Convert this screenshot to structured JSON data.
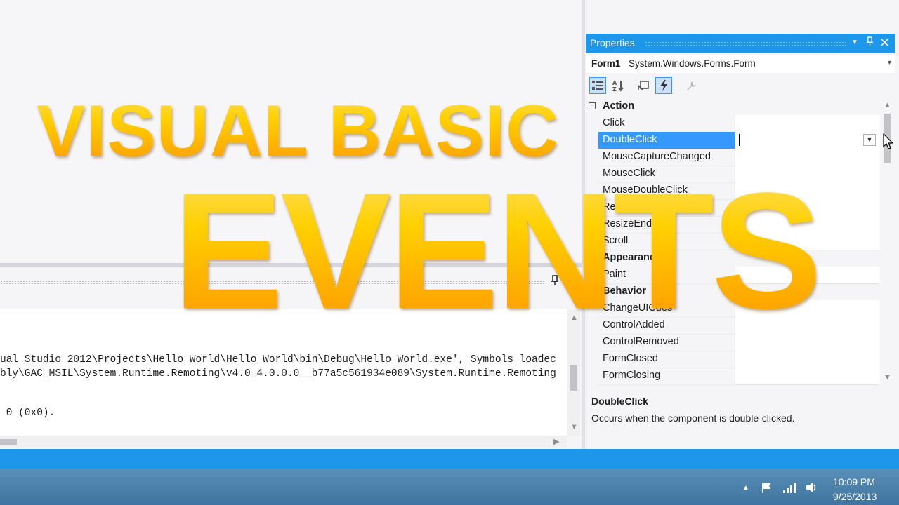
{
  "output": {
    "lines": [
      "ual Studio 2012\\Projects\\Hello World\\Hello World\\bin\\Debug\\Hello World.exe', Symbols loadec",
      "bly\\GAC_MSIL\\System.Runtime.Remoting\\v4.0_4.0.0.0__b77a5c561934e089\\System.Runtime.Remoting",
      "",
      " 0 (0x0)."
    ],
    "pin_icon": "pin-icon",
    "close_icon": "close-icon"
  },
  "properties": {
    "title": "Properties",
    "object_name": "Form1",
    "object_type": "System.Windows.Forms.Form",
    "toolbar": [
      "categorized-icon",
      "alphabetical-icon",
      "properties-icon",
      "events-icon",
      "property-pages-icon"
    ],
    "categories": {
      "action": "Action",
      "appearance": "Appearance",
      "behavior": "Behavior"
    },
    "action_events": [
      "Click",
      "DoubleClick",
      "MouseCaptureChanged",
      "MouseClick",
      "MouseDoubleClick",
      "ResizeBegin",
      "ResizeEnd",
      "Scroll"
    ],
    "appearance_events": [
      "Paint"
    ],
    "behavior_events": [
      "ChangeUICues",
      "ControlAdded",
      "ControlRemoved",
      "FormClosed",
      "FormClosing"
    ],
    "selected_event": "DoubleClick",
    "description_title": "DoubleClick",
    "description_text": "Occurs when the component is double-clicked."
  },
  "taskbar": {
    "time": "10:09 PM",
    "date": "9/25/2013"
  },
  "overlay": {
    "line1": "VISUAL BASIC",
    "line2": "EVENTS"
  },
  "colors": {
    "accent": "#1c97ea",
    "selection": "#3399ff",
    "title_gold": "#ffc400"
  }
}
